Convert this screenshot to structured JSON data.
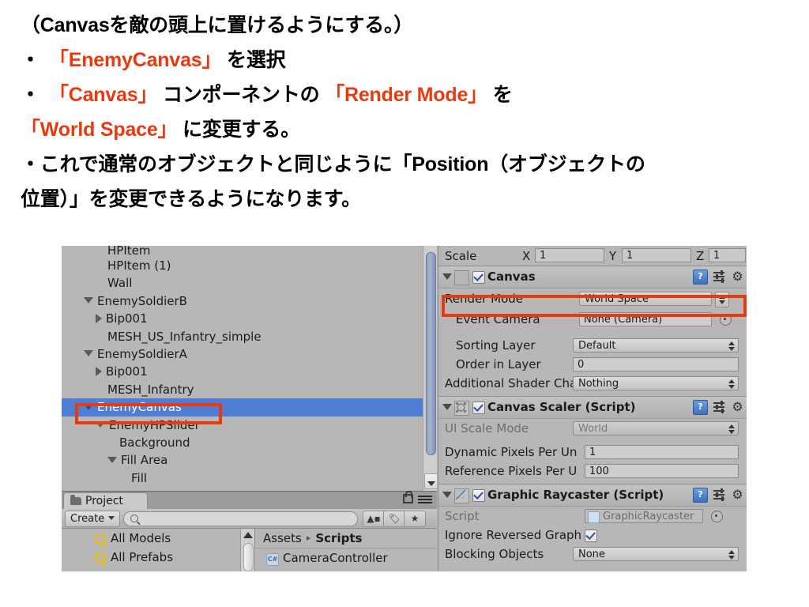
{
  "slide": {
    "lines": [
      [
        {
          "t": "（Canvasを敵の頭上に置けるようにする。）",
          "c": "black"
        }
      ],
      [
        {
          "t": "・ ",
          "c": "black"
        },
        {
          "t": "「EnemyCanvas」",
          "c": "red"
        },
        {
          "t": " を選択",
          "c": "black"
        }
      ],
      [
        {
          "t": "・ ",
          "c": "black"
        },
        {
          "t": "「Canvas」",
          "c": "red"
        },
        {
          "t": " コンポーネントの ",
          "c": "black"
        },
        {
          "t": "「Render Mode」",
          "c": "red"
        },
        {
          "t": " を",
          "c": "black"
        }
      ],
      [
        {
          "t": "「World Space」",
          "c": "red"
        },
        {
          "t": " に変更する。",
          "c": "black"
        }
      ],
      [
        {
          "t": "・これで通常のオブジェクトと同じように「Position（オブジェクトの",
          "c": "black"
        }
      ],
      [
        {
          "t": "位置）」を変更できるようになります。",
          "c": "black"
        }
      ]
    ],
    "accent_red": "#e8390f",
    "text_black": "#000000"
  },
  "hierarchy": {
    "rows": [
      {
        "label": "HPItem",
        "indent": 1,
        "arrow": "none",
        "clipped": true
      },
      {
        "label": "HPItem (1)",
        "indent": 1,
        "arrow": "none"
      },
      {
        "label": "Wall",
        "indent": 1,
        "arrow": "none"
      },
      {
        "label": "EnemySoldierB",
        "indent": 0,
        "arrow": "down"
      },
      {
        "label": "Bip001",
        "indent": 1,
        "arrow": "right"
      },
      {
        "label": "MESH_US_Infantry_simple",
        "indent": 1,
        "arrow": "none"
      },
      {
        "label": "EnemySoldierA",
        "indent": 0,
        "arrow": "down"
      },
      {
        "label": "Bip001",
        "indent": 1,
        "arrow": "right"
      },
      {
        "label": "MESH_Infantry",
        "indent": 1,
        "arrow": "none"
      },
      {
        "label": "EnemyCanvas",
        "indent": 0,
        "arrow": "down",
        "selected": true,
        "highlighted": true
      },
      {
        "label": "EnemyHPSlider",
        "indent": 1,
        "arrow": "down"
      },
      {
        "label": "Background",
        "indent": 2,
        "arrow": "none"
      },
      {
        "label": "Fill Area",
        "indent": 1,
        "arrow": "down"
      },
      {
        "label": "Fill",
        "indent": 2,
        "arrow": "none"
      }
    ],
    "selection_color": "#4f7fd4",
    "scroll_down_icon": "chevron-down-icon"
  },
  "project": {
    "tab_label": "Project",
    "tab_icon": "folder-icon",
    "lock_icon": "lock-icon",
    "menu_icon": "hamburger-menu-icon",
    "create_label": "Create",
    "search_placeholder": "",
    "search_icon": "search-icon",
    "toolbar_icons": [
      "assets-filter-icon",
      "label-filter-icon",
      "favorite-star-icon"
    ],
    "favorites": [
      {
        "label": "All Models",
        "icon": "search-icon"
      },
      {
        "label": "All Prefabs",
        "icon": "search-icon"
      }
    ],
    "breadcrumb": {
      "root": "Assets",
      "separator": "▸",
      "current": "Scripts"
    },
    "assets": [
      {
        "label": "CameraController",
        "icon": "csharp-script-icon"
      }
    ]
  },
  "inspector": {
    "transform": {
      "scale_label": "Scale",
      "axes": [
        {
          "label": "X",
          "value": "1"
        },
        {
          "label": "Y",
          "value": "1"
        },
        {
          "label": "Z",
          "value": "1"
        }
      ]
    },
    "components": [
      {
        "name": "Canvas",
        "enabled": true,
        "icon": "canvas-icon",
        "header_icons": [
          "help-icon",
          "preset-icon",
          "gear-icon"
        ],
        "fields": [
          {
            "label": "Render Mode",
            "value": "World Space",
            "type": "popup",
            "highlighted": true
          },
          {
            "label": "Event Camera",
            "value": "None (Camera)",
            "type": "object",
            "indent": true
          },
          {
            "label": "Sorting Layer",
            "value": "Default",
            "type": "popup",
            "indent": true
          },
          {
            "label": "Order in Layer",
            "value": "0",
            "type": "text",
            "indent": true
          },
          {
            "label": "Additional Shader Cha",
            "value": "Nothing",
            "type": "popup"
          }
        ]
      },
      {
        "name": "Canvas Scaler (Script)",
        "enabled": true,
        "icon": "canvas-scaler-icon",
        "header_icons": [
          "help-icon",
          "preset-icon",
          "gear-icon"
        ],
        "fields": [
          {
            "label": "UI Scale Mode",
            "value": "World",
            "type": "popup",
            "disabled": true
          },
          {
            "label": "Dynamic Pixels Per Un",
            "value": "1",
            "type": "text"
          },
          {
            "label": "Reference Pixels Per U",
            "value": "100",
            "type": "text"
          }
        ]
      },
      {
        "name": "Graphic Raycaster (Script)",
        "enabled": true,
        "icon": "graphic-raycaster-icon",
        "header_icons": [
          "help-icon",
          "preset-icon",
          "gear-icon"
        ],
        "fields": [
          {
            "label": "Script",
            "value": "GraphicRaycaster",
            "type": "object",
            "disabled": true
          },
          {
            "label": "Ignore Reversed Graph",
            "value": "",
            "type": "checkbox",
            "checked": true
          },
          {
            "label": "Blocking Objects",
            "value": "None",
            "type": "popup",
            "clipped": true
          }
        ]
      }
    ]
  },
  "annotations": {
    "color": "#e8390f",
    "boxes": [
      "enemy-canvas-hierarchy-row",
      "render-mode-row"
    ]
  }
}
